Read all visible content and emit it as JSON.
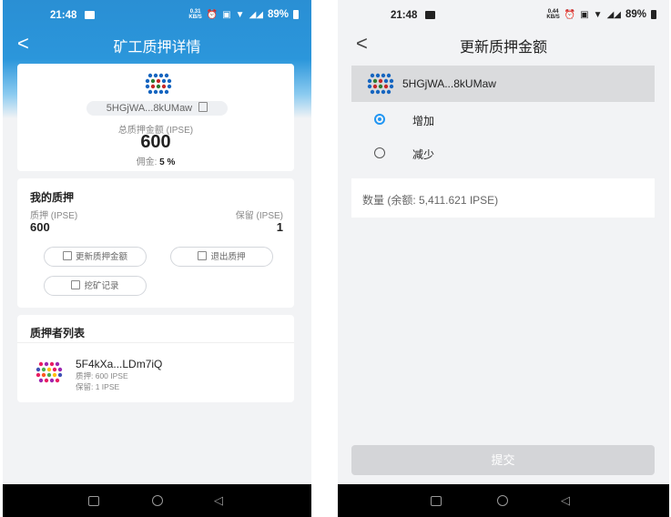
{
  "left": {
    "status": {
      "time": "21:48",
      "speed": "0.31",
      "speed_unit": "KB/S",
      "battery": "89%"
    },
    "nav": {
      "title": "矿工质押详情"
    },
    "miner": {
      "address": "5HGjWA...8kUMaw",
      "total_label": "总质押金额 (IPSE)",
      "total_value": "600",
      "commission_label": "佣金:",
      "commission_value": "5 %"
    },
    "my_pledge": {
      "title": "我的质押",
      "pledge_label": "质押 (IPSE)",
      "pledge_value": "600",
      "reserve_label": "保留 (IPSE)",
      "reserve_value": "1",
      "btn_update": "更新质押金额",
      "btn_exit": "退出质押",
      "btn_history": "挖矿记录"
    },
    "stakers": {
      "title": "质押者列表",
      "items": [
        {
          "name": "5F4kXa...LDm7iQ",
          "pledge": "质押: 600 IPSE",
          "reserve": "保留: 1 IPSE"
        }
      ]
    }
  },
  "right": {
    "status": {
      "time": "21:48",
      "speed": "0.44",
      "speed_unit": "KB/S",
      "battery": "89%"
    },
    "nav": {
      "title": "更新质押金额"
    },
    "selected_miner": "5HGjWA...8kUMaw",
    "options": [
      {
        "label": "增加",
        "selected": true
      },
      {
        "label": "减少",
        "selected": false
      }
    ],
    "amount_placeholder": "数量 (余额: 5,411.621 IPSE)",
    "submit_label": "提交"
  },
  "colors": {
    "header_blue": "#2b96db",
    "radio_accent": "#2196f3",
    "submit_disabled": "#d4d5d8"
  }
}
